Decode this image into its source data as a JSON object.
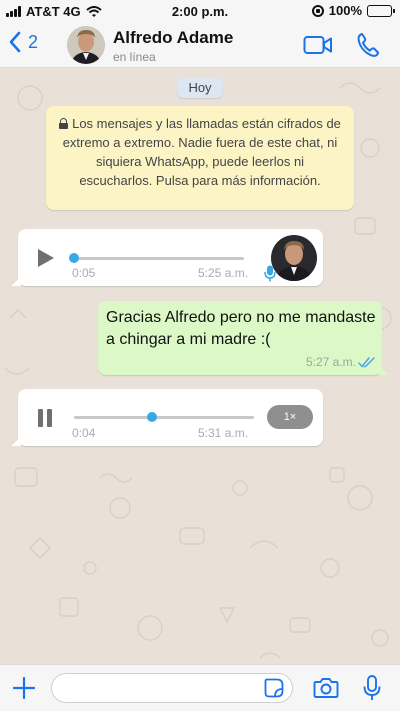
{
  "status_bar": {
    "carrier": "AT&T 4G",
    "time": "2:00 p.m.",
    "battery": "100%"
  },
  "header": {
    "back_count": "2",
    "contact_name": "Alfredo Adame",
    "contact_status": "en línea",
    "avatar_icon": "profile-photo"
  },
  "chat": {
    "date_chip": "Hoy",
    "encryption_notice": "Los mensajes y las llamadas están cifrados de extremo a extremo. Nadie fuera de este chat, ni siquiera WhatsApp, puede leerlos ni escucharlos. Pulsa para más información.",
    "messages": [
      {
        "type": "voice",
        "direction": "incoming",
        "duration": "0:05",
        "time": "5:25 a.m.",
        "state": "paused",
        "progress": 0.0
      },
      {
        "type": "text",
        "direction": "outgoing",
        "text": "Gracias Alfredo pero no me mandaste a chingar a mi madre :(",
        "time": "5:27 a.m.",
        "status": "read"
      },
      {
        "type": "voice",
        "direction": "incoming",
        "duration": "0:04",
        "time": "5:31 a.m.",
        "state": "playing",
        "progress": 0.45,
        "speed": "1×"
      }
    ]
  },
  "input_bar": {
    "placeholder": ""
  },
  "colors": {
    "accent": "#1a73e8",
    "outgoing_bubble": "#dcf8c6",
    "incoming_bubble": "#ffffff",
    "notice_bubble": "#fdf4c5",
    "chat_background": "#e9e1d7",
    "voice_progress": "#35a8e6",
    "read_ticks": "#4fa6e8"
  }
}
